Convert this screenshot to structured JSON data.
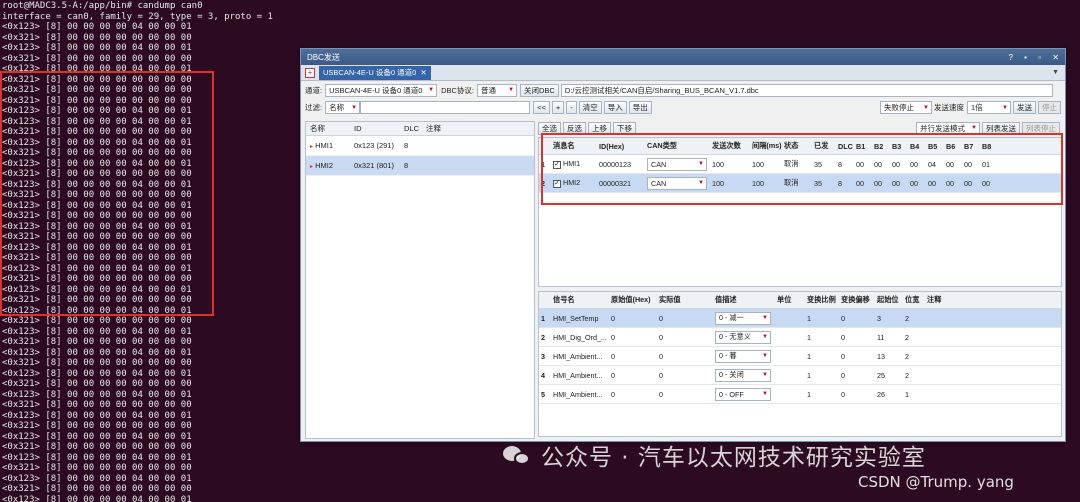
{
  "terminal": {
    "lines": [
      "root@MADC3.5-A:/app/bin# candump can0",
      "interface = can0, family = 29, type = 3, proto = 1",
      "<0x123> [8] 00 00 00 00 04 00 00 01",
      "<0x321> [8] 00 00 00 00 00 00 00 00",
      "<0x123> [8] 00 00 00 00 04 00 00 01",
      "<0x321> [8] 00 00 00 00 00 00 00 00",
      "<0x123> [8] 00 00 00 00 04 00 00 01",
      "<0x321> [8] 00 00 00 00 00 00 00 00",
      "<0x321> [8] 00 00 00 00 00 00 00 00",
      "<0x321> [8] 00 00 00 00 00 00 00 00",
      "<0x123> [8] 00 00 00 00 04 00 00 01",
      "<0x123> [8] 00 00 00 00 04 00 00 01",
      "<0x321> [8] 00 00 00 00 00 00 00 00",
      "<0x123> [8] 00 00 00 00 04 00 00 01",
      "<0x321> [8] 00 00 00 00 00 00 00 00",
      "<0x123> [8] 00 00 00 00 04 00 00 01",
      "<0x321> [8] 00 00 00 00 00 00 00 00",
      "<0x123> [8] 00 00 00 00 04 00 00 01",
      "<0x321> [8] 00 00 00 00 00 00 00 00",
      "<0x123> [8] 00 00 00 00 04 00 00 01",
      "<0x321> [8] 00 00 00 00 00 00 00 00",
      "<0x123> [8] 00 00 00 00 04 00 00 01",
      "<0x321> [8] 00 00 00 00 00 00 00 00",
      "<0x123> [8] 00 00 00 00 04 00 00 01",
      "<0x321> [8] 00 00 00 00 00 00 00 00",
      "<0x123> [8] 00 00 00 00 04 00 00 01",
      "<0x321> [8] 00 00 00 00 00 00 00 00",
      "<0x123> [8] 00 00 00 00 04 00 00 01",
      "<0x321> [8] 00 00 00 00 00 00 00 00",
      "<0x123> [8] 00 00 00 00 04 00 00 01",
      "<0x321> [8] 00 00 00 00 00 00 00 00",
      "<0x123> [8] 00 00 00 00 04 00 00 01",
      "<0x321> [8] 00 00 00 00 00 00 00 00",
      "<0x123> [8] 00 00 00 00 04 00 00 01",
      "<0x321> [8] 00 00 00 00 00 00 00 00",
      "<0x123> [8] 00 00 00 00 04 00 00 01",
      "<0x321> [8] 00 00 00 00 00 00 00 00",
      "<0x123> [8] 00 00 00 00 04 00 00 01",
      "<0x321> [8] 00 00 00 00 00 00 00 00",
      "<0x123> [8] 00 00 00 00 04 00 00 01",
      "<0x321> [8] 00 00 00 00 00 00 00 00",
      "<0x123> [8] 00 00 00 00 04 00 00 01",
      "<0x321> [8] 00 00 00 00 00 00 00 00",
      "<0x123> [8] 00 00 00 00 04 00 00 01",
      "<0x321> [8] 00 00 00 00 00 00 00 00",
      "<0x123> [8] 00 00 00 00 04 00 00 01",
      "<0x321> [8] 00 00 00 00 00 00 00 00",
      "<0x123> [8] 00 00 00 00 04 00 00 01"
    ]
  },
  "window": {
    "title": "DBC发送",
    "controls": [
      "?",
      "▪",
      "▫",
      "✕"
    ],
    "tab_label": "USBCAN-4E-U 设备0 通道0",
    "tab_close": "✕",
    "tab_add": "+",
    "tab_dropdown": "▼"
  },
  "toolbar1": {
    "channel_label": "通道:",
    "channel_value": "USBCAN-4E-U 设备0 通道0",
    "protocol_label": "DBC协议:",
    "protocol_value": "普通",
    "close_dbc": "关闭DBC",
    "dbc_path": "D:/云控测试相关/CAN自启/Sharing_BUS_BCAN_V1.7.dbc"
  },
  "toolbar2": {
    "filter_label": "过滤:",
    "filter_field": "名称",
    "filter_value": "",
    "btn_prev": "<<",
    "btn_plus": "+",
    "btn_minus": "-",
    "btn_clear": "清空",
    "btn_import": "导入",
    "btn_export": "导出",
    "fail_mode": "失败停止",
    "speed_label": "发送速度",
    "speed_value": "1倍",
    "btn_send": "发送",
    "btn_stop": "停止"
  },
  "toolbar3": {
    "btn_select_all": "全选",
    "btn_invert": "反选",
    "btn_up": "上移",
    "btn_down": "下移",
    "mode_value": "并行发送模式",
    "btn_list_send": "列表发送",
    "btn_list_stop": "列表停止"
  },
  "left_list": {
    "headers": [
      "名称",
      "ID",
      "DLC",
      "注释"
    ],
    "rows": [
      {
        "name": "HMI1",
        "id": "0x123 (291)",
        "dlc": "8",
        "note": ""
      },
      {
        "name": "HMI2",
        "id": "0x321 (801)",
        "dlc": "8",
        "note": ""
      }
    ]
  },
  "msg_table": {
    "headers": [
      "消息名",
      "ID(Hex)",
      "CAN类型",
      "发送次数",
      "间隔(ms)",
      "状态",
      "已发",
      "DLC",
      "B1",
      "B2",
      "B3",
      "B4",
      "B5",
      "B6",
      "B7",
      "B8"
    ],
    "rows": [
      {
        "idx": "1",
        "name": "HMI1",
        "id": "00000123",
        "type": "CAN",
        "count": "100",
        "interval": "100",
        "state": "取消",
        "sent": "35",
        "dlc": "8",
        "bytes": [
          "00",
          "00",
          "00",
          "00",
          "04",
          "00",
          "00",
          "01"
        ]
      },
      {
        "idx": "2",
        "name": "HMI2",
        "id": "00000321",
        "type": "CAN",
        "count": "100",
        "interval": "100",
        "state": "取消",
        "sent": "35",
        "dlc": "8",
        "bytes": [
          "00",
          "00",
          "00",
          "00",
          "00",
          "00",
          "00",
          "00"
        ]
      }
    ]
  },
  "sig_table": {
    "headers": [
      "信号名",
      "原始值(Hex)",
      "实际值",
      "值描述",
      "单位",
      "变换比例",
      "变换偏移",
      "起始位",
      "位宽",
      "注释"
    ],
    "rows": [
      {
        "idx": "1",
        "name": "HMI_SetTemp",
        "raw": "0",
        "actual": "0",
        "desc": "0 - 减一",
        "unit": "",
        "scale": "1",
        "offset": "0",
        "start": "3",
        "width": "2"
      },
      {
        "idx": "2",
        "name": "HMI_Dig_Ord_...",
        "raw": "0",
        "actual": "0",
        "desc": "0 - 无意义",
        "unit": "",
        "scale": "1",
        "offset": "0",
        "start": "11",
        "width": "2"
      },
      {
        "idx": "3",
        "name": "HMI_Ambient...",
        "raw": "0",
        "actual": "0",
        "desc": "0 - 暮",
        "unit": "",
        "scale": "1",
        "offset": "0",
        "start": "13",
        "width": "2"
      },
      {
        "idx": "4",
        "name": "HMI_Ambient...",
        "raw": "0",
        "actual": "0",
        "desc": "0 - 关闭",
        "unit": "",
        "scale": "1",
        "offset": "0",
        "start": "25",
        "width": "2"
      },
      {
        "idx": "5",
        "name": "HMI_Ambient...",
        "raw": "0",
        "actual": "0",
        "desc": "0 - OFF",
        "unit": "",
        "scale": "1",
        "offset": "0",
        "start": "26",
        "width": "1"
      }
    ]
  },
  "watermark": "公众号 · 汽车以太网技术研究实验室",
  "credit": "CSDN @Trump. yang",
  "colors": {
    "highlight_box": "#e0302a",
    "terminal_bg": "#2c0a22",
    "selected_row": "#c7d9f3"
  }
}
